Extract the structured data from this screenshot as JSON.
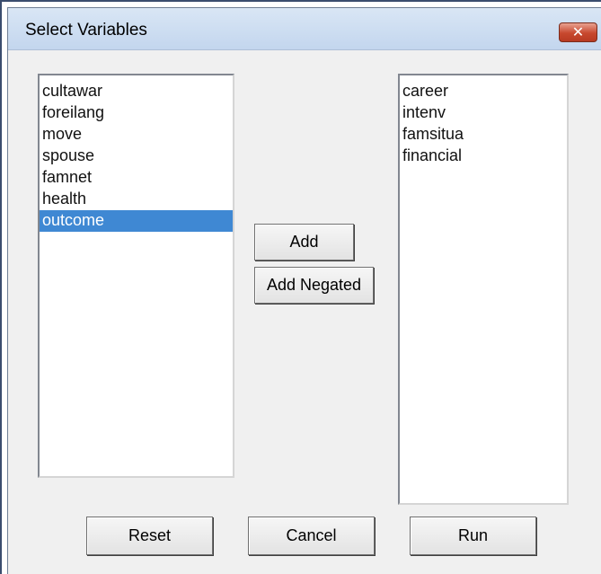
{
  "dialog": {
    "title": "Select Variables",
    "close_icon": "close-icon",
    "available_list": {
      "items": [
        "cultawar",
        "foreilang",
        "move",
        "spouse",
        "famnet",
        "health",
        "outcome"
      ],
      "selected": "outcome"
    },
    "chosen_list": {
      "items": [
        "career",
        "intenv",
        "famsitua",
        "financial"
      ]
    },
    "buttons": {
      "add": "Add",
      "add_negated": "Add Negated",
      "reset": "Reset",
      "cancel": "Cancel",
      "run": "Run"
    }
  },
  "colors": {
    "selection": "#3f88d3",
    "close_button": "#c7482e",
    "dialog_background": "#f0f0f0"
  }
}
